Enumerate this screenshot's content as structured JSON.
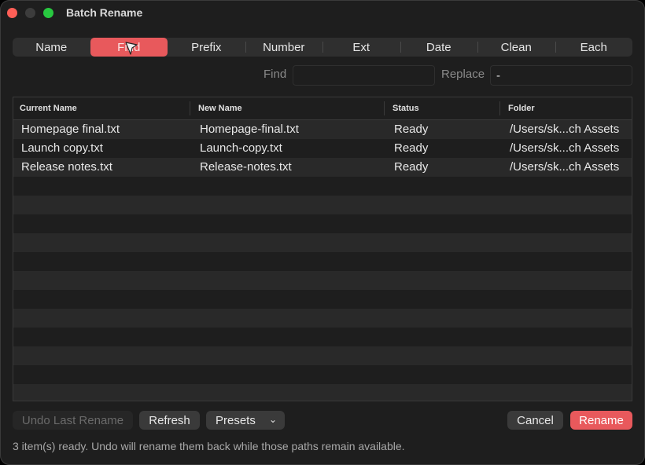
{
  "window": {
    "title": "Batch Rename"
  },
  "tabs": [
    {
      "label": "Name"
    },
    {
      "label": "Find"
    },
    {
      "label": "Prefix"
    },
    {
      "label": "Number"
    },
    {
      "label": "Ext"
    },
    {
      "label": "Date"
    },
    {
      "label": "Clean"
    },
    {
      "label": "Each"
    }
  ],
  "active_tab": "Find",
  "find_replace": {
    "find_label": "Find",
    "find_value": "",
    "replace_label": "Replace",
    "replace_value": "-"
  },
  "table": {
    "columns": [
      "Current Name",
      "New Name",
      "Status",
      "Folder"
    ],
    "rows": [
      {
        "current": "Homepage final.txt",
        "new": "Homepage-final.txt",
        "status": "Ready",
        "folder": "/Users/sk...ch Assets"
      },
      {
        "current": "Launch copy.txt",
        "new": "Launch-copy.txt",
        "status": "Ready",
        "folder": "/Users/sk...ch Assets"
      },
      {
        "current": "Release notes.txt",
        "new": "Release-notes.txt",
        "status": "Ready",
        "folder": "/Users/sk...ch Assets"
      }
    ]
  },
  "buttons": {
    "undo": "Undo Last Rename",
    "refresh": "Refresh",
    "presets": "Presets",
    "cancel": "Cancel",
    "rename": "Rename"
  },
  "status_text": "3 item(s) ready. Undo will rename them back while those paths remain available.",
  "colors": {
    "accent": "#e8595c",
    "background": "#1e1e1e"
  }
}
